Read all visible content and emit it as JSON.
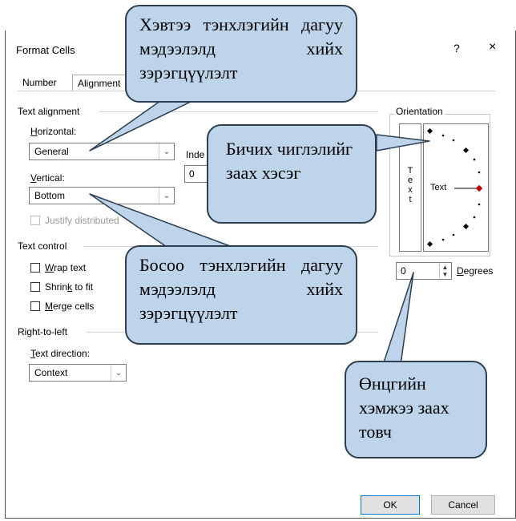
{
  "dialog": {
    "title": "Format Cells",
    "help_label": "?",
    "close_label": "×",
    "tabs": [
      {
        "label": "Number"
      },
      {
        "label": "Alignment"
      }
    ]
  },
  "text_alignment": {
    "section_label": "Text alignment",
    "horizontal_label_u": "H",
    "horizontal_label_rest": "orizontal:",
    "horizontal_value": "General",
    "indent_label": "Inde",
    "indent_value": "0",
    "vertical_label_u": "V",
    "vertical_label_rest": "ertical:",
    "vertical_value": "Bottom",
    "justify_label": "Justify distributed"
  },
  "text_control": {
    "section_label": "Text control",
    "wrap_u": "W",
    "wrap_rest": "rap text",
    "shrink_pre": "Shrin",
    "shrink_u": "k",
    "shrink_rest": " to fit",
    "merge_u": "M",
    "merge_rest": "erge cells"
  },
  "right_to_left": {
    "section_label": "Right-to-left",
    "direction_label_u": "T",
    "direction_label_rest": "ext direction:",
    "direction_value": "Context"
  },
  "orientation": {
    "section_label": "Orientation",
    "vertical_text": [
      "T",
      "e",
      "x",
      "t"
    ],
    "arc_text": "Text",
    "degrees_value": "0",
    "degrees_label_u": "D",
    "degrees_label_rest": "egrees"
  },
  "buttons": {
    "ok": "OK",
    "cancel": "Cancel"
  },
  "callouts": {
    "horizontal": "Хэвтээ тэнхлэгийн дагуу мэдээлэлд хийх зэрэгцүүлэлт",
    "direction": "Бичих чиглэлийг заах хэсэг",
    "vertical": "Босоо тэнхлэгийн дагуу мэдээлэлд хийх зэрэгцүүлэлт",
    "degrees": "Өнцгийн хэмжээ заах товч"
  },
  "colors": {
    "callout_fill": "#bdd4ea",
    "callout_border": "#2c3e50",
    "ok_border": "#0078d7",
    "orientation_marker": "#c00000"
  }
}
